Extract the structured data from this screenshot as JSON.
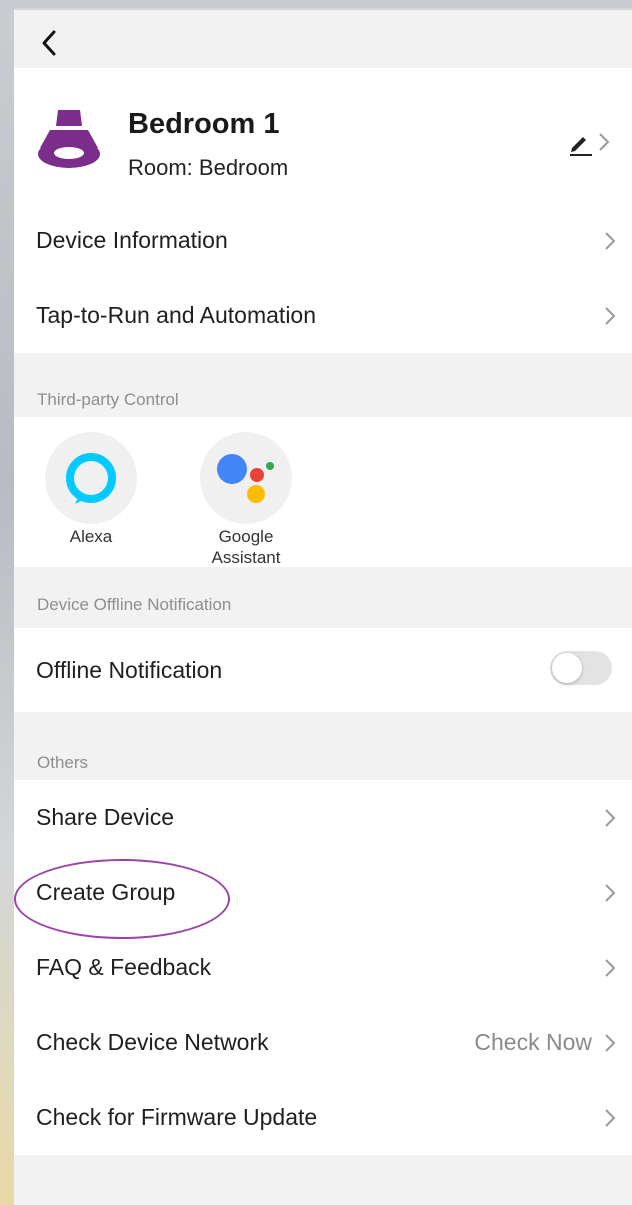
{
  "header": {
    "device_name": "Bedroom 1",
    "room": "Room: Bedroom",
    "accent_color": "#7b2d8b"
  },
  "icons": {
    "back": "chevron-left-icon",
    "edit": "pencil-icon",
    "chevron": "chevron-right-icon",
    "device": "downlight-icon"
  },
  "main_list": [
    {
      "label": "Device Information"
    },
    {
      "label": "Tap-to-Run and Automation"
    }
  ],
  "third_party": {
    "title": "Third-party Control",
    "items": [
      {
        "label": "Alexa",
        "color": "#00caff"
      },
      {
        "label": "Google\nAssistant"
      }
    ]
  },
  "offline": {
    "title": "Device Offline Notification",
    "row_label": "Offline Notification",
    "enabled": false
  },
  "others": {
    "title": "Others",
    "items": [
      {
        "label": "Share Device"
      },
      {
        "label": "Create Group",
        "highlighted": true
      },
      {
        "label": "FAQ & Feedback"
      },
      {
        "label": "Check Device Network",
        "right_text": "Check Now"
      },
      {
        "label": "Check for Firmware Update"
      }
    ]
  },
  "annotation_color": "#9a44a8"
}
